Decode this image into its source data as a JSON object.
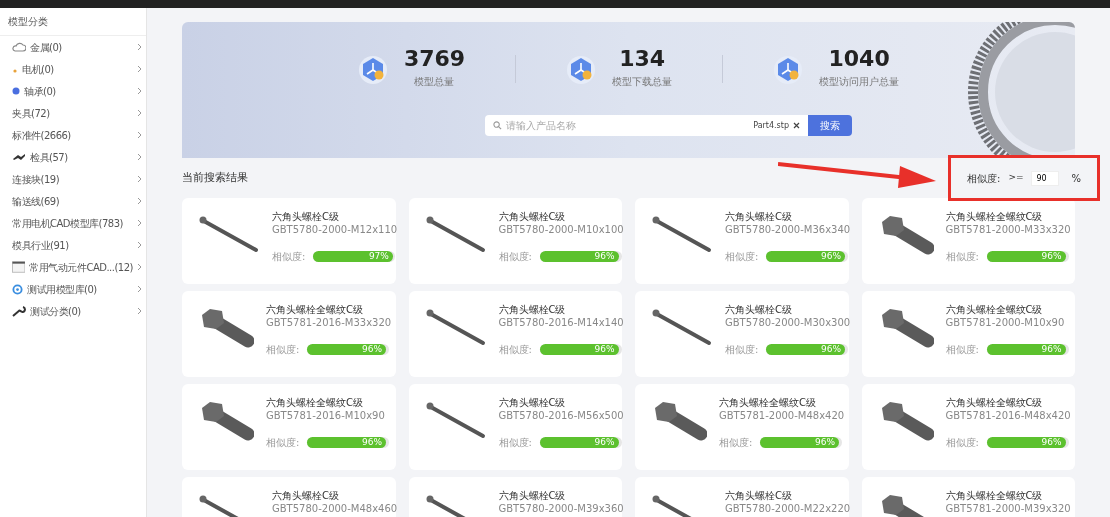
{
  "sidebar": {
    "title": "模型分类",
    "items": [
      {
        "label": "金属(0)",
        "kind": "cloud"
      },
      {
        "label": "电机(0)",
        "kind": "spark"
      },
      {
        "label": "轴承(0)",
        "kind": "dot"
      },
      {
        "label": "夹具(72)",
        "kind": "plain"
      },
      {
        "label": "标准件(2666)",
        "kind": "plain"
      },
      {
        "label": "检具(57)",
        "kind": "tool"
      },
      {
        "label": "连接块(19)",
        "kind": "plain"
      },
      {
        "label": "输送线(69)",
        "kind": "plain"
      },
      {
        "label": "常用电机CAD模型库(783)",
        "kind": "plain"
      },
      {
        "label": "模具行业(91)",
        "kind": "plain"
      },
      {
        "label": "常用气动元件CAD...(12)",
        "kind": "image"
      },
      {
        "label": "测试用模型库(0)",
        "kind": "gear"
      },
      {
        "label": "测试分类(0)",
        "kind": "wrench"
      }
    ]
  },
  "stats": [
    {
      "value": "3769",
      "label": "模型总量"
    },
    {
      "value": "134",
      "label": "模型下载总量"
    },
    {
      "value": "1040",
      "label": "模型访问用户总量"
    }
  ],
  "search": {
    "placeholder": "请输入产品名称",
    "file": "Part4.stp",
    "button": "搜索"
  },
  "results_title": "当前搜索结果",
  "filter": {
    "label": "相似度:",
    "operator": ">=",
    "value": "90",
    "unit": "%"
  },
  "cards": [
    {
      "title": "六角头螺栓C级",
      "code": "GBT5780-2000-M12x110",
      "similarity_label": "相似度:",
      "similarity": "97%",
      "level": 0.97,
      "kind": "long"
    },
    {
      "title": "六角头螺栓C级",
      "code": "GBT5780-2000-M10x100",
      "similarity_label": "相似度:",
      "similarity": "96%",
      "level": 0.96,
      "kind": "long"
    },
    {
      "title": "六角头螺栓C级",
      "code": "GBT5780-2000-M36x340",
      "similarity_label": "相似度:",
      "similarity": "96%",
      "level": 0.96,
      "kind": "long"
    },
    {
      "title": "六角头螺栓全螺纹C级",
      "code": "GBT5781-2000-M33x320",
      "similarity_label": "相似度:",
      "similarity": "96%",
      "level": 0.96,
      "kind": "hex"
    },
    {
      "title": "六角头螺栓全螺纹C级",
      "code": "GBT5781-2016-M33x320",
      "similarity_label": "相似度:",
      "similarity": "96%",
      "level": 0.96,
      "kind": "hex"
    },
    {
      "title": "六角头螺栓C级",
      "code": "GBT5780-2016-M14x140",
      "similarity_label": "相似度:",
      "similarity": "96%",
      "level": 0.96,
      "kind": "long"
    },
    {
      "title": "六角头螺栓C级",
      "code": "GBT5780-2000-M30x300",
      "similarity_label": "相似度:",
      "similarity": "96%",
      "level": 0.96,
      "kind": "long"
    },
    {
      "title": "六角头螺栓全螺纹C级",
      "code": "GBT5781-2000-M10x90",
      "similarity_label": "相似度:",
      "similarity": "96%",
      "level": 0.96,
      "kind": "hex"
    },
    {
      "title": "六角头螺栓全螺纹C级",
      "code": "GBT5781-2016-M10x90",
      "similarity_label": "相似度:",
      "similarity": "96%",
      "level": 0.96,
      "kind": "hex"
    },
    {
      "title": "六角头螺栓C级",
      "code": "GBT5780-2016-M56x500",
      "similarity_label": "相似度:",
      "similarity": "96%",
      "level": 0.96,
      "kind": "long"
    },
    {
      "title": "六角头螺栓全螺纹C级",
      "code": "GBT5781-2000-M48x420",
      "similarity_label": "相似度:",
      "similarity": "96%",
      "level": 0.96,
      "kind": "hex"
    },
    {
      "title": "六角头螺栓全螺纹C级",
      "code": "GBT5781-2016-M48x420",
      "similarity_label": "相似度:",
      "similarity": "96%",
      "level": 0.96,
      "kind": "hex"
    },
    {
      "title": "六角头螺栓C级",
      "code": "GBT5780-2000-M48x460",
      "kind": "long"
    },
    {
      "title": "六角头螺栓C级",
      "code": "GBT5780-2000-M39x360",
      "kind": "long"
    },
    {
      "title": "六角头螺栓C级",
      "code": "GBT5780-2000-M22x220",
      "kind": "long"
    },
    {
      "title": "六角头螺栓全螺纹C级",
      "code": "GBT5781-2000-M39x320",
      "kind": "hex"
    }
  ]
}
